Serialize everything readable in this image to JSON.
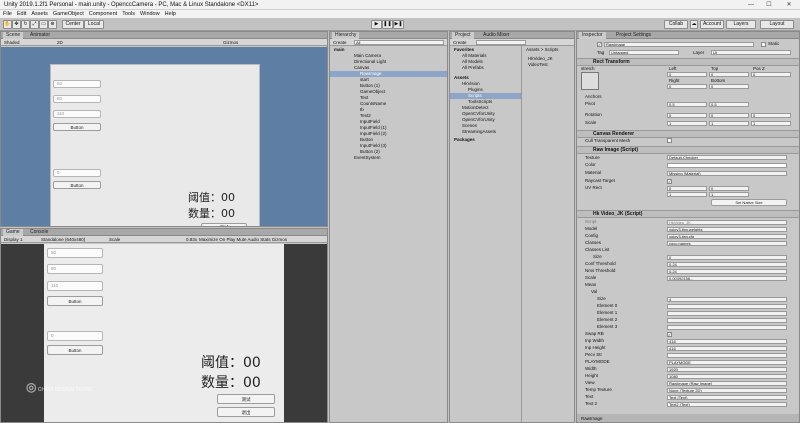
{
  "window": {
    "title": "Unity 2019.1.2f1 Personal - main.unity - OpenccCamera - PC, Mac & Linux Standalone <DX11>"
  },
  "menu": [
    "File",
    "Edit",
    "Assets",
    "GameObject",
    "Component",
    "Tools",
    "Window",
    "Help"
  ],
  "toolbar": {
    "center": "Center",
    "local": "Local",
    "collab": "Collab",
    "account": "Account",
    "layers": "Layers",
    "layout": "Layout"
  },
  "scene": {
    "tab_scene": "Scene",
    "tab_animator": "Animator",
    "shaded": "Shaded",
    "mode2d": "2D",
    "gizmos": "Gizmos",
    "input1": "50",
    "input2": "80",
    "input3": "110",
    "button1": "Button",
    "input4": "0",
    "button2": "Button",
    "threshold": "阈值：00",
    "count": "数量：00",
    "test_btn": "测试",
    "exit_btn": "退出"
  },
  "game": {
    "tab_game": "Game",
    "tab_console": "Console",
    "display": "Display 1",
    "resolution": "Standalone (640x480)",
    "scale_label": "Scale",
    "scale_value": "0.83x",
    "options": "Maximize On Play  Mute Audio  Stats  Gizmos",
    "input1": "50",
    "input2": "80",
    "input3": "110",
    "button1": "Button",
    "input4": "0",
    "button2": "Button",
    "threshold": "阈值：00",
    "count": "数量：00",
    "test_btn": "测试",
    "exit_btn": "退出"
  },
  "hierarchy": {
    "tab": "Hierarchy",
    "create": "Create",
    "search_ph": "All",
    "items": [
      "main",
      "Main Camera",
      "Directional Light",
      "Canvas",
      "RawImage",
      "start",
      "Button (1)",
      "GameObject",
      "Text",
      "CountsName",
      "tb",
      "Text2",
      "InputField",
      "InputField (1)",
      "InputField (2)",
      "Button",
      "InputField (3)",
      "Button (2)",
      "EventSystem"
    ]
  },
  "project": {
    "tab_project": "Project",
    "tab_audio": "Audio Mixer",
    "create": "Create",
    "favorites": "Favorites",
    "fav_items": [
      "All Materials",
      "All Models",
      "All Prefabs"
    ],
    "assets": "Assets",
    "asset_items": [
      "HkVision",
      "Plugins",
      "Scripts",
      "ToolsScripts",
      "MotionDetect",
      "OpenCVforUnity",
      "OpenCVforUnity",
      "Scenes",
      "StreamingAssets"
    ],
    "packages": "Packages",
    "crumb": "Assets > Scripts",
    "files": [
      "HkVideo_JK",
      "VideoTest"
    ]
  },
  "inspector": {
    "tab_inspector": "Inspector",
    "tab_project_settings": "Project Settings",
    "object_name": "RawImage",
    "static": "Static",
    "tag_label": "Tag",
    "tag_value": "Untagged",
    "layer_label": "Layer",
    "layer_value": "UI",
    "rect_transform": "Rect Transform",
    "stretch": "stretch",
    "left": "Left",
    "top": "Top",
    "posz": "Pos Z",
    "left_v": "0",
    "top_v": "0",
    "posz_v": "0",
    "right": "Right",
    "bottom": "Bottom",
    "right_v": "0",
    "bottom_v": "0",
    "anchors": "Anchors",
    "pivot": "Pivot",
    "pivot_x": "0.5",
    "pivot_y": "0.5",
    "rotation": "Rotation",
    "rot_x": "0",
    "rot_y": "0",
    "rot_z": "0",
    "scale": "Scale",
    "scale_x": "1",
    "scale_y": "1",
    "scale_z": "1",
    "canvas_renderer": "Canvas Renderer",
    "cull": "Cull Transparent Mesh",
    "raw_image": "Raw Image (Script)",
    "texture": "Texture",
    "texture_v": "Default-Checker",
    "color": "Color",
    "material": "Material",
    "material_v": "Missing (Material)",
    "raycast": "Raycast Target",
    "uvrect": "UV Rect",
    "uv_x": "0",
    "uv_y": "0",
    "uv_w": "1",
    "uv_h": "1",
    "native": "Set Native Size",
    "hk_script": "Hk Video_JK (Script)",
    "script_label": "Script",
    "script_v": "HkVideo_JK",
    "model": "Model",
    "model_v": "yolov3-tiny.weights",
    "config": "Config",
    "config_v": "yolov3-tiny.cfg",
    "classes": "Classes",
    "classes_v": "coco.names",
    "classes_list": "Classes List",
    "size": "Size",
    "size_v": "0",
    "conf": "Conf Threshold",
    "conf_v": "0.24",
    "nms": "Nms Threshold",
    "nms_v": "0.24",
    "scale2": "Scale",
    "scale2_v": "0.00392156...",
    "mean": "Mean",
    "val": "Val",
    "vsize": "Size",
    "vsize_v": "4",
    "e0": "Element 0",
    "e1": "Element 1",
    "e2": "Element 2",
    "e3": "Element 3",
    "swap": "Swap RB",
    "inpw": "Inp Width",
    "inpw_v": "416",
    "inph": "Inp Height",
    "inph_v": "416",
    "pcsc": "Pecv Str",
    "playmode": "PLAYMODE",
    "playmode_v": "PLAYMODE",
    "width": "Width",
    "width_v": "1920",
    "height": "Height",
    "height_v": "1080",
    "view": "View",
    "view_v": "RawImage (Raw Image)",
    "temptex": "Temp Texture",
    "temptex_v": "None (Texture 2D)",
    "text": "Text",
    "text_v": "Text (Text)",
    "text2": "Text 2",
    "text2_v": "Text2 (Text)",
    "footer": "RawImage"
  },
  "watermark": "CHINA DESIGN SCENE"
}
